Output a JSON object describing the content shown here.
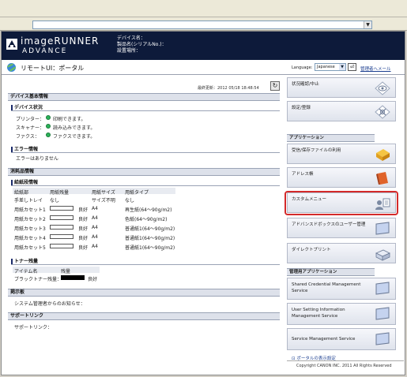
{
  "browser": {
    "dropdown_arrow": "▼"
  },
  "header": {
    "brand_line1": "imageRUNNER",
    "brand_line2": "ADVANCE",
    "device_name_label": "デバイス名：",
    "product_label": "製品名(シリアルNo.)：",
    "location_label": "設置場所："
  },
  "subheader": {
    "title": "リモートUI：ポータル",
    "language_label": "Language:",
    "language_value": "Japanese",
    "admin_link": "管理者へメール"
  },
  "updated": "最終更新：2012 05/18 18:48:54",
  "device_info": {
    "section": "デバイス基本情報",
    "status_title": "デバイス状況",
    "rows": [
      {
        "label": "プリンター：",
        "value": "印刷できます。"
      },
      {
        "label": "スキャナー：",
        "value": "読み込みできます。"
      },
      {
        "label": "ファクス：",
        "value": "ファクスできます。"
      }
    ],
    "error_title": "エラー情報",
    "error_text": "エラーはありません"
  },
  "consumables": {
    "section": "消耗品情報",
    "paper_title": "給紙段情報",
    "paper_headers": [
      "給紙部",
      "用紙残量",
      "用紙サイズ",
      "用紙タイプ"
    ],
    "paper_rows": [
      {
        "source": "手差しトレイ",
        "remain": "なし",
        "size": "サイズ不明",
        "type": "なし"
      },
      {
        "source": "用紙カセット1",
        "remain": "良好",
        "size": "A4",
        "type": "再生紙(64～90g/m2)"
      },
      {
        "source": "用紙カセット2",
        "remain": "良好",
        "size": "A4",
        "type": "色紙(64～90g/m2)"
      },
      {
        "source": "用紙カセット3",
        "remain": "良好",
        "size": "A4",
        "type": "普通紙1(64～90g/m2)"
      },
      {
        "source": "用紙カセット4",
        "remain": "良好",
        "size": "A4",
        "type": "普通紙1(64～90g/m2)"
      },
      {
        "source": "用紙カセット5",
        "remain": "良好",
        "size": "A4",
        "type": "普通紙1(64～90g/m2)"
      }
    ],
    "toner_title": "トナー残量",
    "toner_headers": [
      "アイテム名",
      "残量"
    ],
    "toner_row": {
      "item": "ブラックトナー残量：",
      "remain": "良好"
    }
  },
  "notice": {
    "section": "掲示板",
    "text": "システム管理者からのお知らせ："
  },
  "support": {
    "section": "サポートリンク",
    "text": "サポートリンク："
  },
  "right": {
    "btn_status": "状況確認/中止",
    "btn_settings": "設定/登録",
    "apps_section": "アプリケーション",
    "btn_files": "受信/保存ファイルの利用",
    "btn_address": "アドレス帳",
    "btn_custom": "カスタムメニュー",
    "btn_advbox": "アドバンスドボックスのユーザー管理",
    "btn_direct": "ダイレクトプリント",
    "mgmt_section": "管理用アプリケーション",
    "btn_shared1": "Shared Credential Management",
    "btn_shared2": "Service",
    "btn_user1": "User Setting Information",
    "btn_user2": "Management Service",
    "btn_service": "Service Management Service",
    "portal_link": "ポータルの表示設定",
    "copyright": "Copyright CANON INC. 2011 All Rights Reserved"
  },
  "colors": {
    "header_bg": "#0d1a3a",
    "highlight": "#d42a2a",
    "status_ok": "#2bb35a"
  }
}
